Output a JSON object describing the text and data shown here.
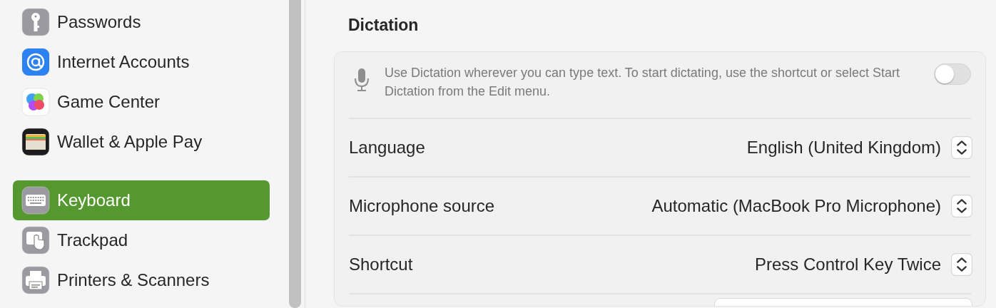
{
  "sidebar": {
    "groups": [
      {
        "items": [
          {
            "label": "Passwords",
            "selected": false
          },
          {
            "label": "Internet Accounts",
            "selected": false
          },
          {
            "label": "Game Center",
            "selected": false
          },
          {
            "label": "Wallet & Apple Pay",
            "selected": false
          }
        ]
      },
      {
        "items": [
          {
            "label": "Keyboard",
            "selected": true
          },
          {
            "label": "Trackpad",
            "selected": false
          },
          {
            "label": "Printers & Scanners",
            "selected": false
          }
        ]
      }
    ]
  },
  "section": {
    "title": "Dictation",
    "description": "Use Dictation wherever you can type text. To start dictating, use the shortcut or select Start Dictation from the Edit menu.",
    "dictation_toggle": {
      "on": false
    },
    "rows": [
      {
        "label": "Language",
        "value": "English (United Kingdom)"
      },
      {
        "label": "Microphone source",
        "value": "Automatic (MacBook Pro Microphone)"
      },
      {
        "label": "Shortcut",
        "value": "Press Control Key Twice"
      }
    ]
  }
}
